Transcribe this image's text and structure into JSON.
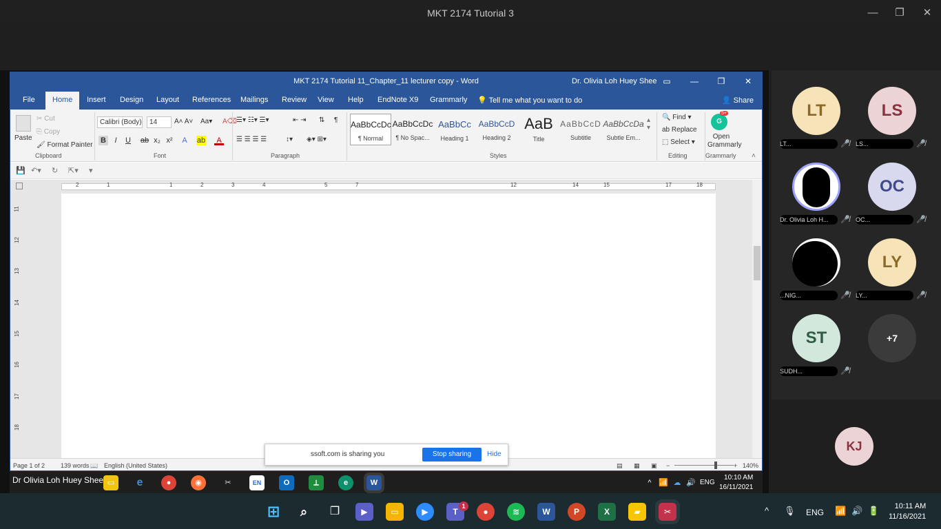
{
  "outer_window": {
    "title": "MKT 2174 Tutorial 3"
  },
  "word": {
    "doc_title": "MKT 2174 Tutorial 11_Chapter_11 lecturer copy  -  Word",
    "user_name": "Dr. Olivia Loh Huey Shee",
    "tabs": [
      "File",
      "Home",
      "Insert",
      "Design",
      "Layout",
      "References",
      "Mailings",
      "Review",
      "View",
      "Help",
      "EndNote X9",
      "Grammarly"
    ],
    "tell_me": "Tell me what you want to do",
    "share": "Share",
    "clipboard": {
      "paste": "Paste",
      "cut": "Cut",
      "copy": "Copy",
      "format_painter": "Format Painter",
      "label": "Clipboard"
    },
    "font": {
      "name": "Calibri (Body)",
      "size": "14",
      "label": "Font"
    },
    "paragraph_label": "Paragraph",
    "styles": [
      {
        "preview": "AaBbCcDc",
        "name": "¶ Normal"
      },
      {
        "preview": "AaBbCcDc",
        "name": "¶ No Spac..."
      },
      {
        "preview": "AaBbCc",
        "name": "Heading 1"
      },
      {
        "preview": "AaBbCcD",
        "name": "Heading 2"
      },
      {
        "preview": "AaB",
        "name": "Title"
      },
      {
        "preview": "AaBbCcD",
        "name": "Subtitle"
      },
      {
        "preview": "AaBbCcDa",
        "name": "Subtle Em..."
      }
    ],
    "styles_label": "Styles",
    "editing": {
      "find": "Find",
      "replace": "Replace",
      "select": "Select",
      "label": "Editing"
    },
    "grammarly": {
      "open": "Open Grammarly",
      "label": "Grammarly",
      "badge": "5+"
    },
    "ruler_numbers": [
      "2",
      "1",
      "1",
      "1",
      "2",
      "3",
      "4",
      "5",
      "7",
      "12",
      "14",
      "15",
      "17",
      "18"
    ],
    "vruler_numbers": [
      "11",
      "12",
      "13",
      "14",
      "15",
      "16",
      "17",
      "18"
    ],
    "status": {
      "page": "Page 1 of 2",
      "words": "139 words",
      "language": "English (United States)",
      "zoom": "140%"
    },
    "zoom_level": 0.7
  },
  "share_toast": {
    "message": "ssoft.com is sharing you",
    "stop": "Stop sharing",
    "hide": "Hide"
  },
  "inner_taskbar": {
    "presenter": "Dr Olivia Loh Huey Shee",
    "lang": "ENG",
    "time": "10:10 AM",
    "date": "16/11/2021"
  },
  "participants": [
    {
      "initials": "LT",
      "color": "#f6e4b8",
      "text": "#8a6a2a",
      "name": "LT..."
    },
    {
      "initials": "LS",
      "color": "#ecd3d6",
      "text": "#8a3340",
      "name": "LS..."
    },
    {
      "initials": "",
      "color": "#000000",
      "text": "#ffffff",
      "name": "Dr. Olivia Loh H..."
    },
    {
      "initials": "OC",
      "color": "#d8d8ee",
      "text": "#3f4a8a",
      "name": "OC..."
    },
    {
      "initials": "",
      "color": "#000000",
      "text": "#ffffff",
      "name": "...NIG..."
    },
    {
      "initials": "LY",
      "color": "#f6e4b8",
      "text": "#8a6a2a",
      "name": "LY..."
    },
    {
      "initials": "ST",
      "color": "#d3e8dc",
      "text": "#2f5e44",
      "name": "SUDH..."
    },
    {
      "initials": "+7",
      "color": "#3b3b3b",
      "text": "#ffffff",
      "name": ""
    }
  ],
  "self_tile": {
    "initials": "KJ"
  },
  "outer_taskbar": {
    "lang": "ENG",
    "time": "10:11 AM",
    "date": "11/16/2021",
    "teams_badge": "1"
  }
}
